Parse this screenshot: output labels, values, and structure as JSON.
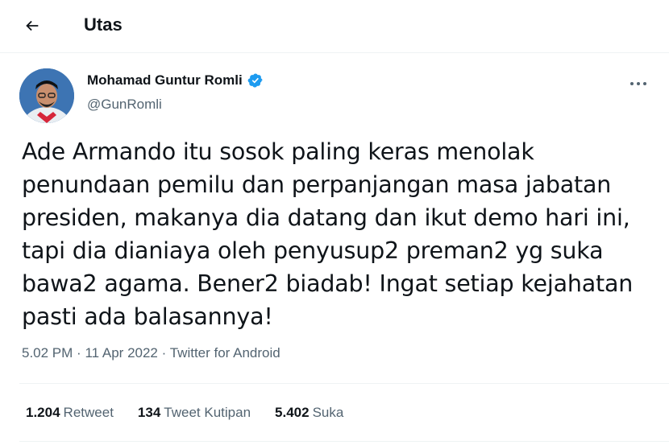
{
  "header": {
    "title": "Utas",
    "back_icon": "arrow-left-icon"
  },
  "tweet": {
    "author_name": "Mohamad Guntur Romli",
    "verified_icon": "verified-badge-icon",
    "handle": "@GunRomli",
    "more_icon": "more-options-icon",
    "text_lines": [
      "Ade Armando itu sosok paling keras menolak",
      "penundaan pemilu dan perpanjangan masa jabatan",
      "presiden, makanya dia datang dan ikut demo hari ini,",
      "tapi dia dianiaya oleh penyusup2 preman2 yg suka",
      "bawa2 agama. Bener2 biadab! Ingat setiap kejahatan",
      "pasti ada balasannya!"
    ],
    "time": "5.02 PM",
    "date": "11 Apr 2022",
    "source": "Twitter for Android",
    "separator": "·"
  },
  "stats": [
    {
      "count": "1.204",
      "label": "Retweet"
    },
    {
      "count": "134",
      "label": "Tweet Kutipan"
    },
    {
      "count": "5.402",
      "label": "Suka"
    }
  ],
  "colors": {
    "text": "#0f1419",
    "secondary": "#536471",
    "verified": "#1d9bf0",
    "divider": "#eff3f4"
  }
}
